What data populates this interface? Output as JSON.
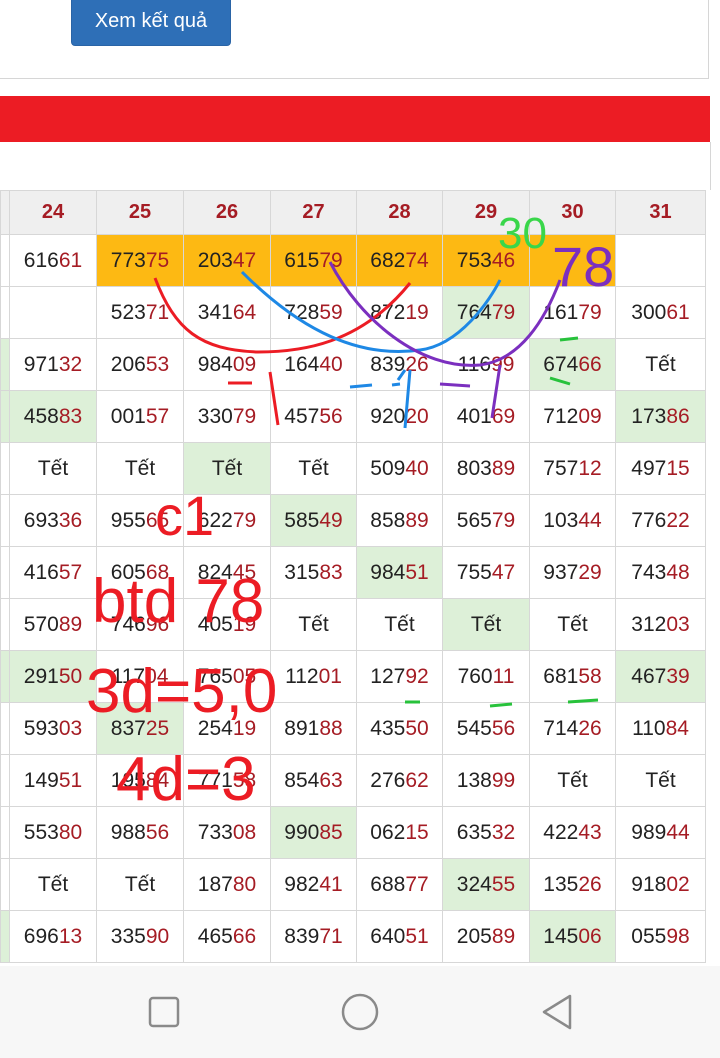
{
  "button": {
    "label": "Xem kết quả"
  },
  "table": {
    "days": [
      "24",
      "25",
      "26",
      "27",
      "28",
      "29",
      "30",
      "31"
    ],
    "rows": [
      [
        "61661",
        "77375",
        "20347",
        "61579",
        "68274",
        "75346",
        "",
        ""
      ],
      [
        "",
        "52371",
        "34164",
        "72859",
        "87219",
        "76479",
        "16179",
        "30061"
      ],
      [
        "97132",
        "20653",
        "98409",
        "16440",
        "83926",
        "11699",
        "67466",
        "Tết"
      ],
      [
        "45883",
        "00157",
        "33079",
        "45756",
        "92020",
        "40169",
        "71209",
        "17386"
      ],
      [
        "Tết",
        "Tết",
        "Tết",
        "Tết",
        "50940",
        "80389",
        "75712",
        "49715"
      ],
      [
        "69336",
        "95565",
        "62279",
        "58549",
        "85889",
        "56579",
        "10344",
        "77622"
      ],
      [
        "41657",
        "60568",
        "82445",
        "31583",
        "98451",
        "75547",
        "93729",
        "74348"
      ],
      [
        "57089",
        "74696",
        "40519",
        "Tết",
        "Tết",
        "Tết",
        "Tết",
        "31203"
      ],
      [
        "29150",
        "11704",
        "76505",
        "11201",
        "12792",
        "76011",
        "68158",
        "46739"
      ],
      [
        "59303",
        "83725",
        "25419",
        "89188",
        "43550",
        "54556",
        "71426",
        "11084"
      ],
      [
        "14951",
        "19584",
        "77158",
        "85463",
        "27662",
        "13899",
        "Tết",
        "Tết"
      ],
      [
        "55380",
        "98856",
        "73308",
        "99085",
        "06215",
        "63532",
        "42243",
        "98944"
      ],
      [
        "Tết",
        "Tết",
        "18780",
        "98241",
        "68877",
        "32455",
        "13526",
        "91802"
      ],
      [
        "69613",
        "33590",
        "46566",
        "83971",
        "64051",
        "20589",
        "14506",
        "05598"
      ]
    ]
  },
  "annotations": {
    "note_30": "30",
    "note_78": "78",
    "note_c1": "c1",
    "note_btd": "btd 78",
    "note_3d": "3d=5,0",
    "note_4d": "4d=3"
  },
  "colors": {
    "accent_red": "#ec1c24",
    "orange": "#fdb913",
    "green": "#ddf0d8",
    "tail_red": "#a51c24",
    "button_blue": "#2e6fb7"
  },
  "icons": {
    "nav_home": "square-icon",
    "nav_circle": "circle-icon",
    "nav_back": "triangle-back-icon"
  }
}
